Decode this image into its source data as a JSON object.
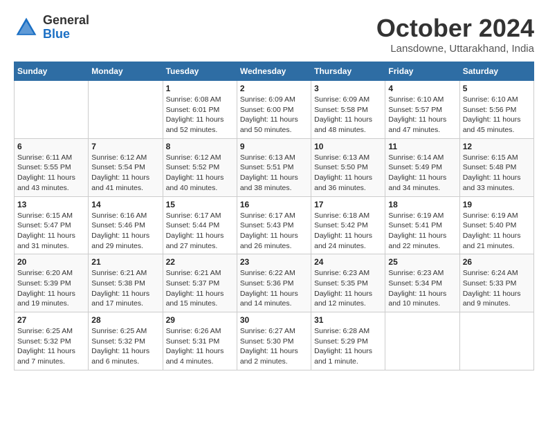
{
  "header": {
    "logo_general": "General",
    "logo_blue": "Blue",
    "month_title": "October 2024",
    "location": "Lansdowne, Uttarakhand, India"
  },
  "weekdays": [
    "Sunday",
    "Monday",
    "Tuesday",
    "Wednesday",
    "Thursday",
    "Friday",
    "Saturday"
  ],
  "weeks": [
    [
      {
        "day": "",
        "info": ""
      },
      {
        "day": "",
        "info": ""
      },
      {
        "day": "1",
        "info": "Sunrise: 6:08 AM\nSunset: 6:01 PM\nDaylight: 11 hours and 52 minutes."
      },
      {
        "day": "2",
        "info": "Sunrise: 6:09 AM\nSunset: 6:00 PM\nDaylight: 11 hours and 50 minutes."
      },
      {
        "day": "3",
        "info": "Sunrise: 6:09 AM\nSunset: 5:58 PM\nDaylight: 11 hours and 48 minutes."
      },
      {
        "day": "4",
        "info": "Sunrise: 6:10 AM\nSunset: 5:57 PM\nDaylight: 11 hours and 47 minutes."
      },
      {
        "day": "5",
        "info": "Sunrise: 6:10 AM\nSunset: 5:56 PM\nDaylight: 11 hours and 45 minutes."
      }
    ],
    [
      {
        "day": "6",
        "info": "Sunrise: 6:11 AM\nSunset: 5:55 PM\nDaylight: 11 hours and 43 minutes."
      },
      {
        "day": "7",
        "info": "Sunrise: 6:12 AM\nSunset: 5:54 PM\nDaylight: 11 hours and 41 minutes."
      },
      {
        "day": "8",
        "info": "Sunrise: 6:12 AM\nSunset: 5:52 PM\nDaylight: 11 hours and 40 minutes."
      },
      {
        "day": "9",
        "info": "Sunrise: 6:13 AM\nSunset: 5:51 PM\nDaylight: 11 hours and 38 minutes."
      },
      {
        "day": "10",
        "info": "Sunrise: 6:13 AM\nSunset: 5:50 PM\nDaylight: 11 hours and 36 minutes."
      },
      {
        "day": "11",
        "info": "Sunrise: 6:14 AM\nSunset: 5:49 PM\nDaylight: 11 hours and 34 minutes."
      },
      {
        "day": "12",
        "info": "Sunrise: 6:15 AM\nSunset: 5:48 PM\nDaylight: 11 hours and 33 minutes."
      }
    ],
    [
      {
        "day": "13",
        "info": "Sunrise: 6:15 AM\nSunset: 5:47 PM\nDaylight: 11 hours and 31 minutes."
      },
      {
        "day": "14",
        "info": "Sunrise: 6:16 AM\nSunset: 5:46 PM\nDaylight: 11 hours and 29 minutes."
      },
      {
        "day": "15",
        "info": "Sunrise: 6:17 AM\nSunset: 5:44 PM\nDaylight: 11 hours and 27 minutes."
      },
      {
        "day": "16",
        "info": "Sunrise: 6:17 AM\nSunset: 5:43 PM\nDaylight: 11 hours and 26 minutes."
      },
      {
        "day": "17",
        "info": "Sunrise: 6:18 AM\nSunset: 5:42 PM\nDaylight: 11 hours and 24 minutes."
      },
      {
        "day": "18",
        "info": "Sunrise: 6:19 AM\nSunset: 5:41 PM\nDaylight: 11 hours and 22 minutes."
      },
      {
        "day": "19",
        "info": "Sunrise: 6:19 AM\nSunset: 5:40 PM\nDaylight: 11 hours and 21 minutes."
      }
    ],
    [
      {
        "day": "20",
        "info": "Sunrise: 6:20 AM\nSunset: 5:39 PM\nDaylight: 11 hours and 19 minutes."
      },
      {
        "day": "21",
        "info": "Sunrise: 6:21 AM\nSunset: 5:38 PM\nDaylight: 11 hours and 17 minutes."
      },
      {
        "day": "22",
        "info": "Sunrise: 6:21 AM\nSunset: 5:37 PM\nDaylight: 11 hours and 15 minutes."
      },
      {
        "day": "23",
        "info": "Sunrise: 6:22 AM\nSunset: 5:36 PM\nDaylight: 11 hours and 14 minutes."
      },
      {
        "day": "24",
        "info": "Sunrise: 6:23 AM\nSunset: 5:35 PM\nDaylight: 11 hours and 12 minutes."
      },
      {
        "day": "25",
        "info": "Sunrise: 6:23 AM\nSunset: 5:34 PM\nDaylight: 11 hours and 10 minutes."
      },
      {
        "day": "26",
        "info": "Sunrise: 6:24 AM\nSunset: 5:33 PM\nDaylight: 11 hours and 9 minutes."
      }
    ],
    [
      {
        "day": "27",
        "info": "Sunrise: 6:25 AM\nSunset: 5:32 PM\nDaylight: 11 hours and 7 minutes."
      },
      {
        "day": "28",
        "info": "Sunrise: 6:25 AM\nSunset: 5:32 PM\nDaylight: 11 hours and 6 minutes."
      },
      {
        "day": "29",
        "info": "Sunrise: 6:26 AM\nSunset: 5:31 PM\nDaylight: 11 hours and 4 minutes."
      },
      {
        "day": "30",
        "info": "Sunrise: 6:27 AM\nSunset: 5:30 PM\nDaylight: 11 hours and 2 minutes."
      },
      {
        "day": "31",
        "info": "Sunrise: 6:28 AM\nSunset: 5:29 PM\nDaylight: 11 hours and 1 minute."
      },
      {
        "day": "",
        "info": ""
      },
      {
        "day": "",
        "info": ""
      }
    ]
  ]
}
